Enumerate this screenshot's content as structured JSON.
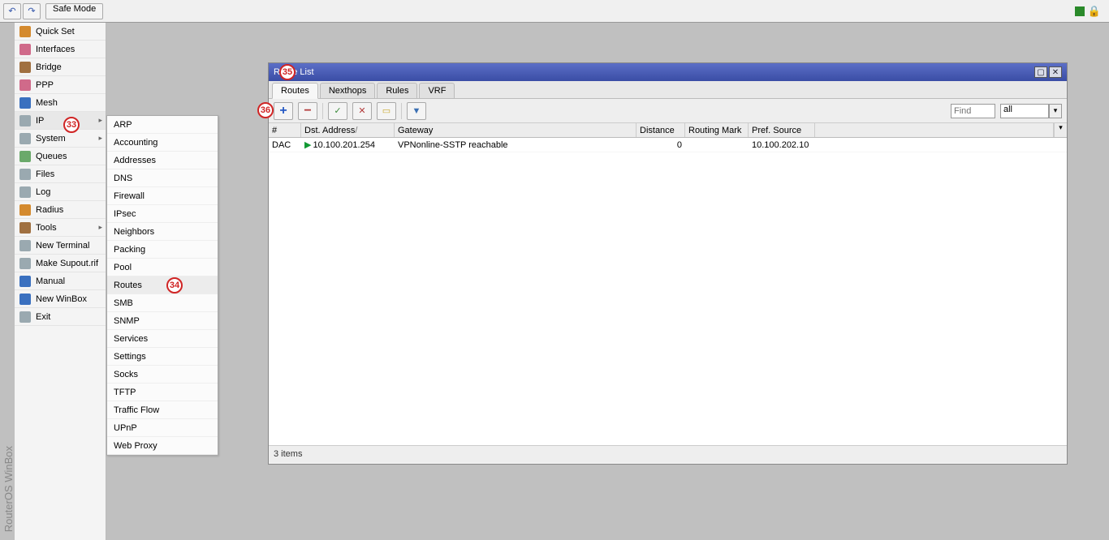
{
  "toolbar": {
    "safe_mode": "Safe Mode"
  },
  "vertical_title": "RouterOS WinBox",
  "sidebar": [
    {
      "label": "Quick Set",
      "cls": "orange"
    },
    {
      "label": "Interfaces",
      "cls": "pink"
    },
    {
      "label": "Bridge",
      "cls": "brown"
    },
    {
      "label": "PPP",
      "cls": "pink"
    },
    {
      "label": "Mesh",
      "cls": "blue"
    },
    {
      "label": "IP",
      "cls": "gray",
      "arrow": true
    },
    {
      "label": "System",
      "cls": "gray",
      "arrow": true
    },
    {
      "label": "Queues",
      "cls": "green"
    },
    {
      "label": "Files",
      "cls": "gray"
    },
    {
      "label": "Log",
      "cls": "gray"
    },
    {
      "label": "Radius",
      "cls": "orange"
    },
    {
      "label": "Tools",
      "cls": "brown",
      "arrow": true
    },
    {
      "label": "New Terminal",
      "cls": "gray"
    },
    {
      "label": "Make Supout.rif",
      "cls": "gray"
    },
    {
      "label": "Manual",
      "cls": "blue"
    },
    {
      "label": "New WinBox",
      "cls": "blue"
    },
    {
      "label": "Exit",
      "cls": "gray"
    }
  ],
  "submenu": [
    "ARP",
    "Accounting",
    "Addresses",
    "DNS",
    "Firewall",
    "IPsec",
    "Neighbors",
    "Packing",
    "Pool",
    "Routes",
    "SMB",
    "SNMP",
    "Services",
    "Settings",
    "Socks",
    "TFTP",
    "Traffic Flow",
    "UPnP",
    "Web Proxy"
  ],
  "window": {
    "title": "Route List",
    "tabs": [
      "Routes",
      "Nexthops",
      "Rules",
      "VRF"
    ],
    "active_tab": 0,
    "find_placeholder": "Find",
    "filter_all": "all",
    "columns": [
      "#",
      "Dst. Address",
      "Gateway",
      "Distance",
      "Routing Mark",
      "Pref. Source"
    ],
    "rows": [
      {
        "flags": "DAC",
        "dst": "10.100.201.254",
        "gateway": "VPNonline-SSTP reachable",
        "distance": "0",
        "mark": "",
        "src": "10.100.202.10"
      }
    ],
    "status": "3 items"
  },
  "annotations": {
    "a33": "33",
    "a34": "34",
    "a35": "35",
    "a36": "36"
  }
}
